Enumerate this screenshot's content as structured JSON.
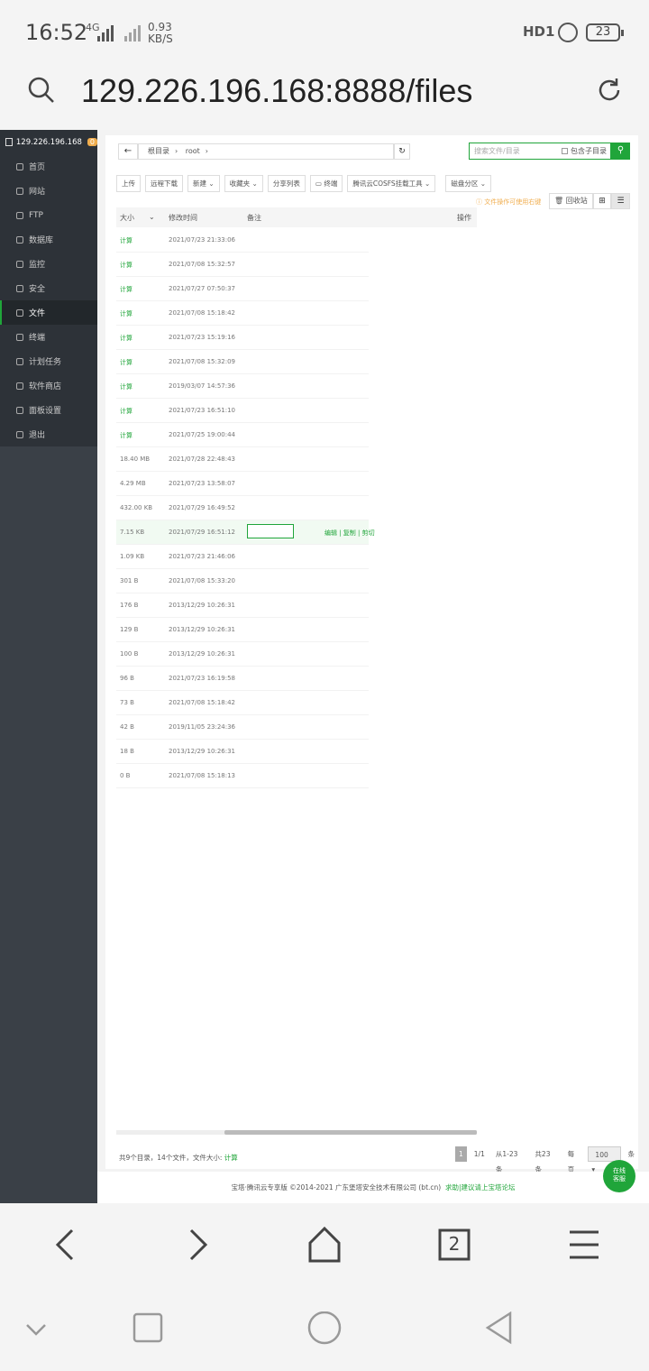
{
  "status_bar": {
    "time": "16:52",
    "network": "4G",
    "speed_value": "0.93",
    "speed_unit": "KB/S",
    "hd_label": "HD1",
    "battery": "23"
  },
  "browser": {
    "url": "129.226.196.168:8888/files",
    "tab_count": "2"
  },
  "sidebar": {
    "server_ip": "129.226.196.168",
    "badge_count": "0",
    "items": [
      {
        "label": "首页",
        "icon": "home-icon"
      },
      {
        "label": "网站",
        "icon": "globe-icon"
      },
      {
        "label": "FTP",
        "icon": "ftp-icon"
      },
      {
        "label": "数据库",
        "icon": "database-icon"
      },
      {
        "label": "监控",
        "icon": "monitor-icon"
      },
      {
        "label": "安全",
        "icon": "shield-icon"
      },
      {
        "label": "文件",
        "icon": "folder-icon",
        "active": true
      },
      {
        "label": "终端",
        "icon": "terminal-icon"
      },
      {
        "label": "计划任务",
        "icon": "calendar-icon"
      },
      {
        "label": "软件商店",
        "icon": "apps-icon"
      },
      {
        "label": "面板设置",
        "icon": "gear-icon"
      },
      {
        "label": "退出",
        "icon": "logout-icon"
      }
    ]
  },
  "breadcrumb": {
    "root": "根目录",
    "current": "root"
  },
  "search": {
    "placeholder": "搜索文件/目录",
    "include_sub": "包含子目录"
  },
  "toolbar": {
    "upload": "上传",
    "remote_download": "远程下载",
    "new": "新建",
    "favorites": "收藏夹",
    "share_list": "分享列表",
    "terminal": "终端",
    "cosfs": "腾讯云COSFS挂载工具",
    "disk": "磁盘分区"
  },
  "tip": "文件操作可使用右键",
  "recycle_bin": "回收站",
  "table": {
    "headers": {
      "size": "大小",
      "mtime": "修改时间",
      "note": "备注",
      "ops": "操作"
    },
    "rows": [
      {
        "size": "计算",
        "time": "2021/07/23 21:33:06",
        "calc": true
      },
      {
        "size": "计算",
        "time": "2021/07/08 15:32:57",
        "calc": true
      },
      {
        "size": "计算",
        "time": "2021/07/27 07:50:37",
        "calc": true
      },
      {
        "size": "计算",
        "time": "2021/07/08 15:18:42",
        "calc": true
      },
      {
        "size": "计算",
        "time": "2021/07/23 15:19:16",
        "calc": true
      },
      {
        "size": "计算",
        "time": "2021/07/08 15:32:09",
        "calc": true
      },
      {
        "size": "计算",
        "time": "2019/03/07 14:57:36",
        "calc": true
      },
      {
        "size": "计算",
        "time": "2021/07/23 16:51:10",
        "calc": true
      },
      {
        "size": "计算",
        "time": "2021/07/25 19:00:44",
        "calc": true
      },
      {
        "size": "18.40 MB",
        "time": "2021/07/28 22:48:43"
      },
      {
        "size": "4.29 MB",
        "time": "2021/07/23 13:58:07"
      },
      {
        "size": "432.00 KB",
        "time": "2021/07/29 16:49:52"
      },
      {
        "size": "7.15 KB",
        "time": "2021/07/29 16:51:12",
        "highlight": true,
        "ops": "编辑 | 复制 | 剪切"
      },
      {
        "size": "1.09 KB",
        "time": "2021/07/23 21:46:06"
      },
      {
        "size": "301 B",
        "time": "2021/07/08 15:33:20"
      },
      {
        "size": "176 B",
        "time": "2013/12/29 10:26:31"
      },
      {
        "size": "129 B",
        "time": "2013/12/29 10:26:31"
      },
      {
        "size": "100 B",
        "time": "2013/12/29 10:26:31"
      },
      {
        "size": "96 B",
        "time": "2021/07/23 16:19:58"
      },
      {
        "size": "73 B",
        "time": "2021/07/08 15:18:42"
      },
      {
        "size": "42 B",
        "time": "2019/11/05 23:24:36"
      },
      {
        "size": "18 B",
        "time": "2013/12/29 10:26:31"
      },
      {
        "size": "0 B",
        "time": "2021/07/08 15:18:13"
      }
    ]
  },
  "summary": {
    "text": "共9个目录，14个文件，文件大小:",
    "link": "计算"
  },
  "pager": {
    "current": "1",
    "pages": "1/1",
    "range": "从1-23条",
    "total": "共23条",
    "per_page_label": "每页",
    "per_page": "100",
    "unit": "条"
  },
  "footer": {
    "text": "宝塔·腾讯云专享版 ©2014-2021 广东堡塔安全技术有限公司 (bt.cn)",
    "link": "求助|建议请上宝塔论坛"
  },
  "chat": {
    "line1": "在线",
    "line2": "客服"
  },
  "colors": {
    "accent": "#20a53a",
    "sidebar": "#3a4047",
    "warning": "#f0ad4e"
  }
}
